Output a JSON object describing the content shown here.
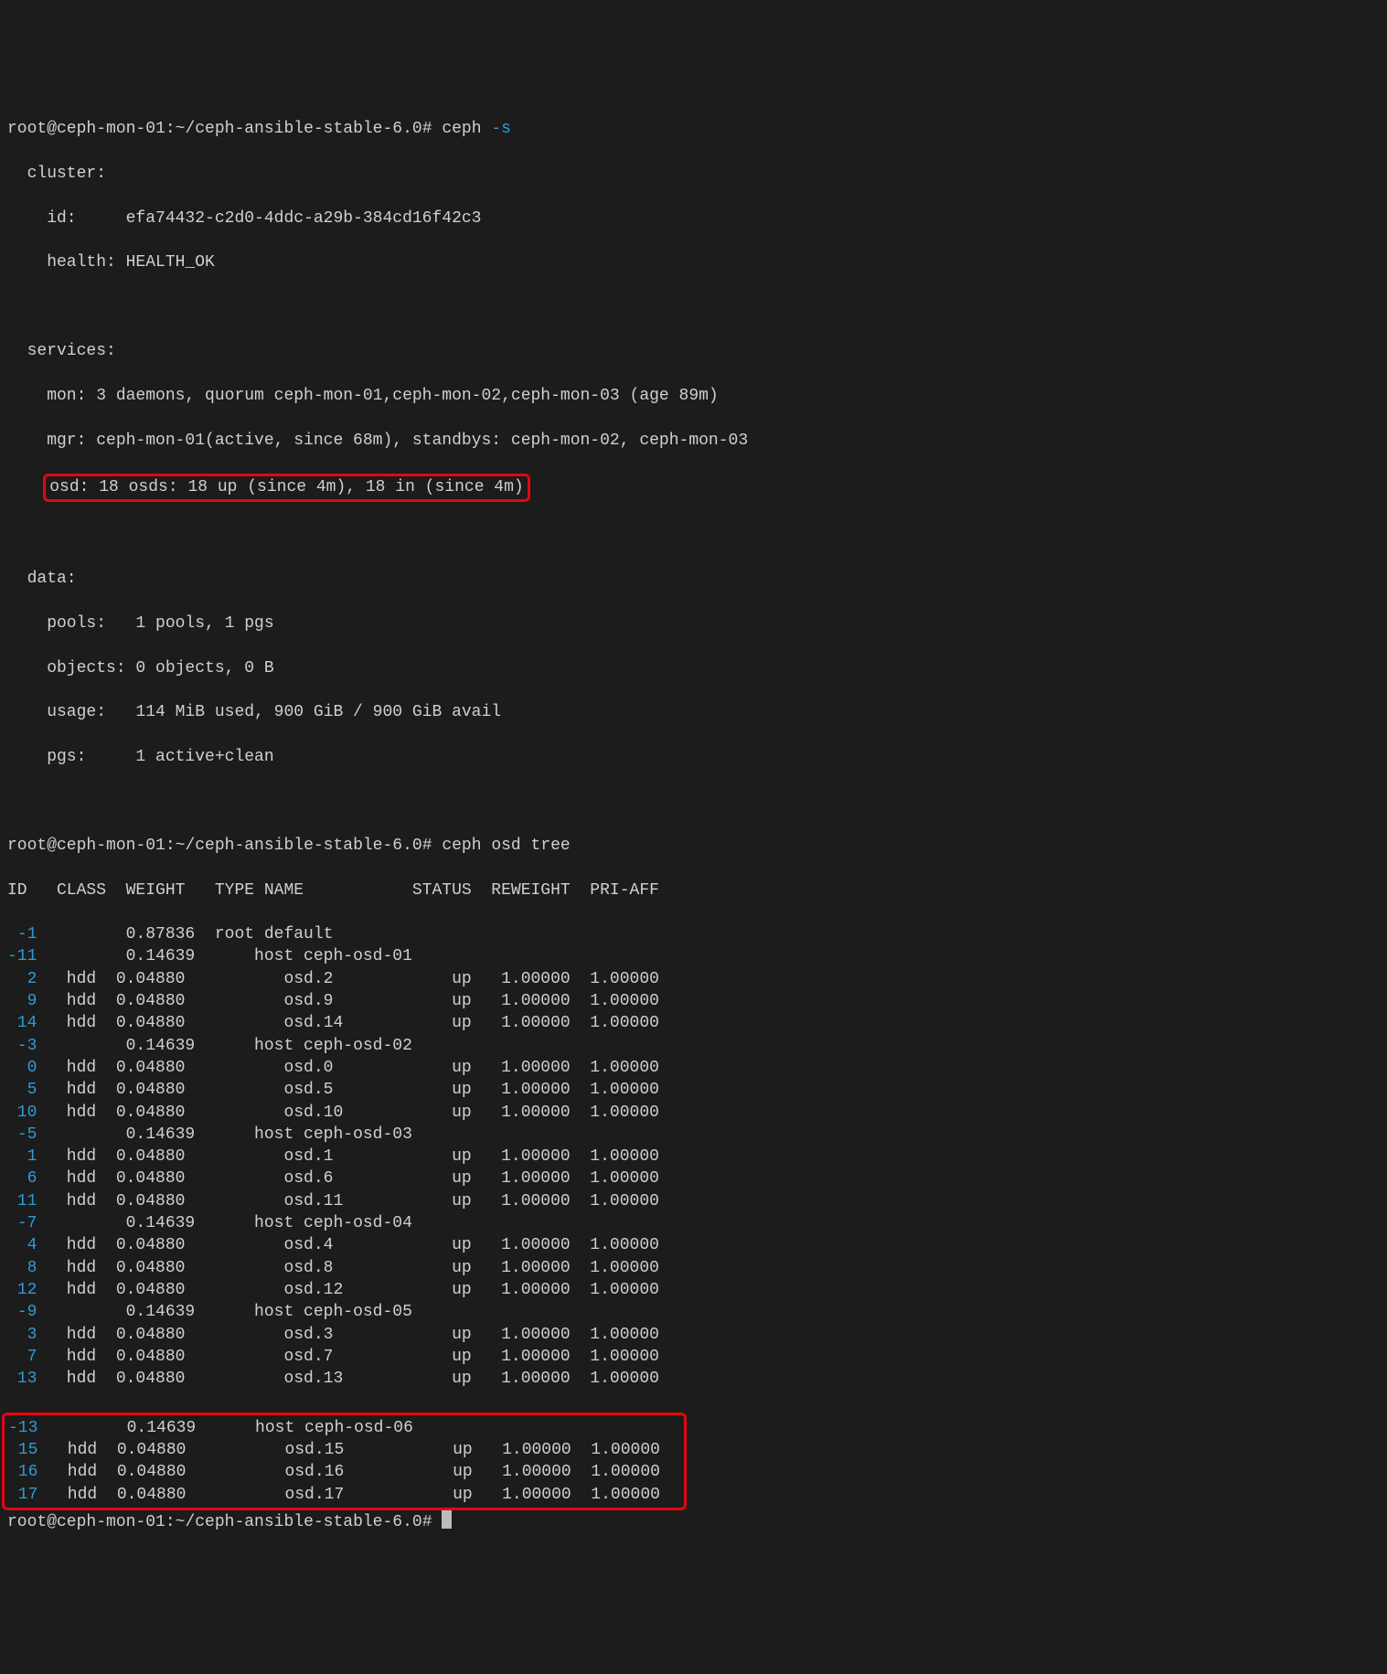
{
  "prompt1": {
    "userHost": "root@ceph-mon-01",
    "colon": ":",
    "path": "~/ceph-ansible-stable-6.0",
    "hash": "#",
    "cmd": "ceph",
    "flag": "-s"
  },
  "cluster": {
    "header": "  cluster:",
    "id_label": "    id:     ",
    "id_value": "efa74432-c2d0-4ddc-a29b-384cd16f42c3",
    "health_label": "    health: ",
    "health_value": "HEALTH_OK"
  },
  "services": {
    "header": "  services:",
    "mon": "    mon: 3 daemons, quorum ceph-mon-01,ceph-mon-02,ceph-mon-03 (age 89m)",
    "mgr": "    mgr: ceph-mon-01(active, since 68m), standbys: ceph-mon-02, ceph-mon-03",
    "osd_pre": "    ",
    "osd_highlight": "osd: 18 osds: 18 up (since 4m), 18 in (since 4m)"
  },
  "data": {
    "header": "  data:",
    "pools": "    pools:   1 pools, 1 pgs",
    "objects": "    objects: 0 objects, 0 B",
    "usage": "    usage:   114 MiB used, 900 GiB / 900 GiB avail",
    "pgs": "    pgs:     1 active+clean"
  },
  "prompt2": {
    "userHost": "root@ceph-mon-01",
    "colon": ":",
    "path": "~/ceph-ansible-stable-6.0",
    "hash": "#",
    "cmd": "ceph osd tree"
  },
  "tree": {
    "header": "ID   CLASS  WEIGHT   TYPE NAME           STATUS  REWEIGHT  PRI-AFF",
    "rows": [
      {
        "id": " -1",
        "rest": "         0.87836  root default                                  "
      },
      {
        "id": "-11",
        "rest": "         0.14639      host ceph-osd-01                           "
      },
      {
        "id": "  2",
        "rest": "   hdd  0.04880          osd.2            up   1.00000  1.00000"
      },
      {
        "id": "  9",
        "rest": "   hdd  0.04880          osd.9            up   1.00000  1.00000"
      },
      {
        "id": " 14",
        "rest": "   hdd  0.04880          osd.14           up   1.00000  1.00000"
      },
      {
        "id": " -3",
        "rest": "         0.14639      host ceph-osd-02                           "
      },
      {
        "id": "  0",
        "rest": "   hdd  0.04880          osd.0            up   1.00000  1.00000"
      },
      {
        "id": "  5",
        "rest": "   hdd  0.04880          osd.5            up   1.00000  1.00000"
      },
      {
        "id": " 10",
        "rest": "   hdd  0.04880          osd.10           up   1.00000  1.00000"
      },
      {
        "id": " -5",
        "rest": "         0.14639      host ceph-osd-03                           "
      },
      {
        "id": "  1",
        "rest": "   hdd  0.04880          osd.1            up   1.00000  1.00000"
      },
      {
        "id": "  6",
        "rest": "   hdd  0.04880          osd.6            up   1.00000  1.00000"
      },
      {
        "id": " 11",
        "rest": "   hdd  0.04880          osd.11           up   1.00000  1.00000"
      },
      {
        "id": " -7",
        "rest": "         0.14639      host ceph-osd-04                           "
      },
      {
        "id": "  4",
        "rest": "   hdd  0.04880          osd.4            up   1.00000  1.00000"
      },
      {
        "id": "  8",
        "rest": "   hdd  0.04880          osd.8            up   1.00000  1.00000"
      },
      {
        "id": " 12",
        "rest": "   hdd  0.04880          osd.12           up   1.00000  1.00000"
      },
      {
        "id": " -9",
        "rest": "         0.14639      host ceph-osd-05                           "
      },
      {
        "id": "  3",
        "rest": "   hdd  0.04880          osd.3            up   1.00000  1.00000"
      },
      {
        "id": "  7",
        "rest": "   hdd  0.04880          osd.7            up   1.00000  1.00000"
      },
      {
        "id": " 13",
        "rest": "   hdd  0.04880          osd.13           up   1.00000  1.00000"
      }
    ],
    "highlight_rows": [
      {
        "id": "-13",
        "rest": "         0.14639      host ceph-osd-06                           "
      },
      {
        "id": " 15",
        "rest": "   hdd  0.04880          osd.15           up   1.00000  1.00000"
      },
      {
        "id": " 16",
        "rest": "   hdd  0.04880          osd.16           up   1.00000  1.00000"
      },
      {
        "id": " 17",
        "rest": "   hdd  0.04880          osd.17           up   1.00000  1.00000"
      }
    ]
  },
  "prompt3": {
    "userHost": "root@ceph-mon-01",
    "colon": ":",
    "path": "~/ceph-ansible-stable-6.0",
    "hash": "#"
  }
}
